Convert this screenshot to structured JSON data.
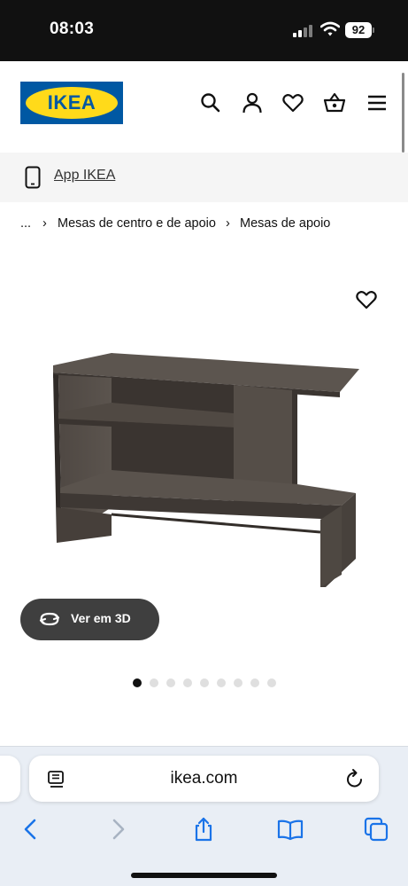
{
  "status_bar": {
    "time": "08:03",
    "battery": "92"
  },
  "header": {
    "logo_text": "IKEA",
    "icons": [
      "search-icon",
      "account-icon",
      "favourites-icon",
      "basket-icon",
      "menu-icon"
    ]
  },
  "app_banner": {
    "label": "App IKEA",
    "icon": "smartphone-icon"
  },
  "breadcrumb": {
    "ellipsis": "...",
    "separator": "›",
    "items": [
      "Mesas de centro e de apoio",
      "Mesas de apoio"
    ]
  },
  "product": {
    "favourite_icon": "heart-outline-icon",
    "view3d_label": "Ver em 3D",
    "view3d_icon": "rotate-3d-icon",
    "gallery_count": 9,
    "gallery_active_index": 0
  },
  "browser": {
    "url": "ikea.com",
    "icons": [
      "reader-icon",
      "reload-icon",
      "back-icon",
      "forward-icon",
      "share-icon",
      "bookmarks-icon",
      "tabs-icon"
    ]
  },
  "colors": {
    "ikea_blue": "#0058a3",
    "ikea_yellow": "#ffda1a",
    "safari_accent": "#1a73e8",
    "button_dark": "#3f3f3f"
  }
}
